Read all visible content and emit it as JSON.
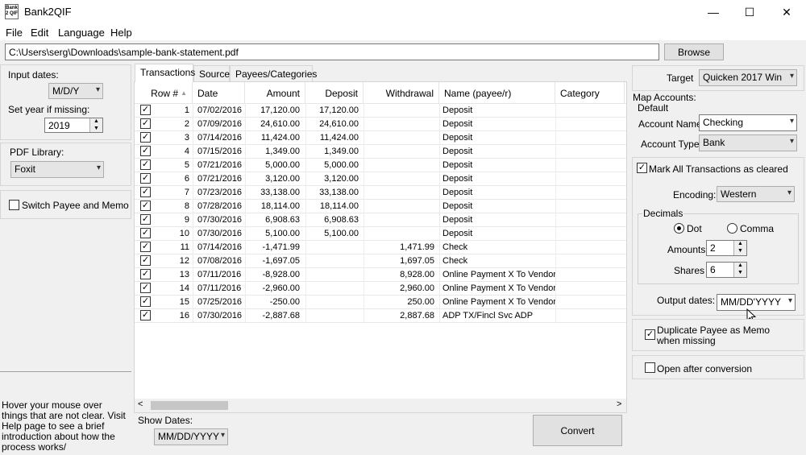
{
  "window": {
    "title": "Bank2QIF",
    "icon_text": "Bank 2 QIF",
    "minimize": "—",
    "maximize": "☐",
    "close": "✕"
  },
  "menu": [
    "File",
    "Edit",
    "Language",
    "Help"
  ],
  "path": {
    "value": "C:\\Users\\serg\\Downloads\\sample-bank-statement.pdf",
    "browse_label": "Browse"
  },
  "left": {
    "input_dates_label": "Input dates:",
    "input_dates_value": "M/D/Y",
    "set_year_label": "Set year if missing:",
    "set_year_value": "2019",
    "pdf_library_label": "PDF Library:",
    "pdf_library_value": "Foxit",
    "switch_label": "Switch Payee and Memo",
    "help_text": "Hover your mouse over things that are not clear. Visit Help page to see a brief introduction about how the process works/"
  },
  "tabs": [
    "Transactions",
    "Source",
    "Payees/Categories"
  ],
  "table": {
    "headers": [
      "Row #",
      "Date",
      "Amount",
      "Deposit",
      "Withdrawal",
      "Name (payee/r)",
      "Category"
    ],
    "rows": [
      [
        "1",
        "07/02/2016",
        "17,120.00",
        "17,120.00",
        "",
        "Deposit"
      ],
      [
        "2",
        "07/09/2016",
        "24,610.00",
        "24,610.00",
        "",
        "Deposit"
      ],
      [
        "3",
        "07/14/2016",
        "11,424.00",
        "11,424.00",
        "",
        "Deposit"
      ],
      [
        "4",
        "07/15/2016",
        "1,349.00",
        "1,349.00",
        "",
        "Deposit"
      ],
      [
        "5",
        "07/21/2016",
        "5,000.00",
        "5,000.00",
        "",
        "Deposit"
      ],
      [
        "6",
        "07/21/2016",
        "3,120.00",
        "3,120.00",
        "",
        "Deposit"
      ],
      [
        "7",
        "07/23/2016",
        "33,138.00",
        "33,138.00",
        "",
        "Deposit"
      ],
      [
        "8",
        "07/28/2016",
        "18,114.00",
        "18,114.00",
        "",
        "Deposit"
      ],
      [
        "9",
        "07/30/2016",
        "6,908.63",
        "6,908.63",
        "",
        "Deposit"
      ],
      [
        "10",
        "07/30/2016",
        "5,100.00",
        "5,100.00",
        "",
        "Deposit"
      ],
      [
        "11",
        "07/14/2016",
        "-1,471.99",
        "",
        "1,471.99",
        "Check"
      ],
      [
        "12",
        "07/08/2016",
        "-1,697.05",
        "",
        "1,697.05",
        "Check"
      ],
      [
        "13",
        "07/11/2016",
        "-8,928.00",
        "",
        "8,928.00",
        "Online Payment X To Vendor"
      ],
      [
        "14",
        "07/11/2016",
        "-2,960.00",
        "",
        "2,960.00",
        "Online Payment X To Vendor"
      ],
      [
        "15",
        "07/25/2016",
        "-250.00",
        "",
        "250.00",
        "Online Payment X To Vendor"
      ],
      [
        "16",
        "07/30/2016",
        "-2,887.68",
        "",
        "2,887.68",
        "ADP TX/Fincl Svc ADP"
      ]
    ]
  },
  "bottom": {
    "show_dates_label": "Show Dates:",
    "show_dates_value": "MM/DD/YYYY",
    "convert_label": "Convert",
    "scroll_left": "<",
    "scroll_right": ">"
  },
  "right": {
    "target_label": "Target",
    "target_value": "Quicken 2017 Win",
    "map_accounts_label": "Map Accounts:",
    "default_label": "Default",
    "account_name_label": "Account Name:",
    "account_name_value": "Checking",
    "account_type_label": "Account Type:",
    "account_type_value": "Bank",
    "mark_cleared_label": "Mark All Transactions as cleared",
    "encoding_label": "Encoding:",
    "encoding_value": "Western",
    "decimals_label": "Decimals",
    "dot_label": "Dot",
    "comma_label": "Comma",
    "amounts_label": "Amounts",
    "amounts_value": "2",
    "shares_label": "Shares",
    "shares_value": "6",
    "output_dates_label": "Output dates:",
    "output_dates_value": "MM/DD'YYYY",
    "duplicate_label": "Duplicate Payee as Memo when missing",
    "open_after_label": "Open after conversion"
  },
  "icons": {
    "dropdown": "▾",
    "check": "✓",
    "sort_up": "▲",
    "spin_up": "▲",
    "spin_down": "▼",
    "cursor": "mouse-cursor"
  }
}
